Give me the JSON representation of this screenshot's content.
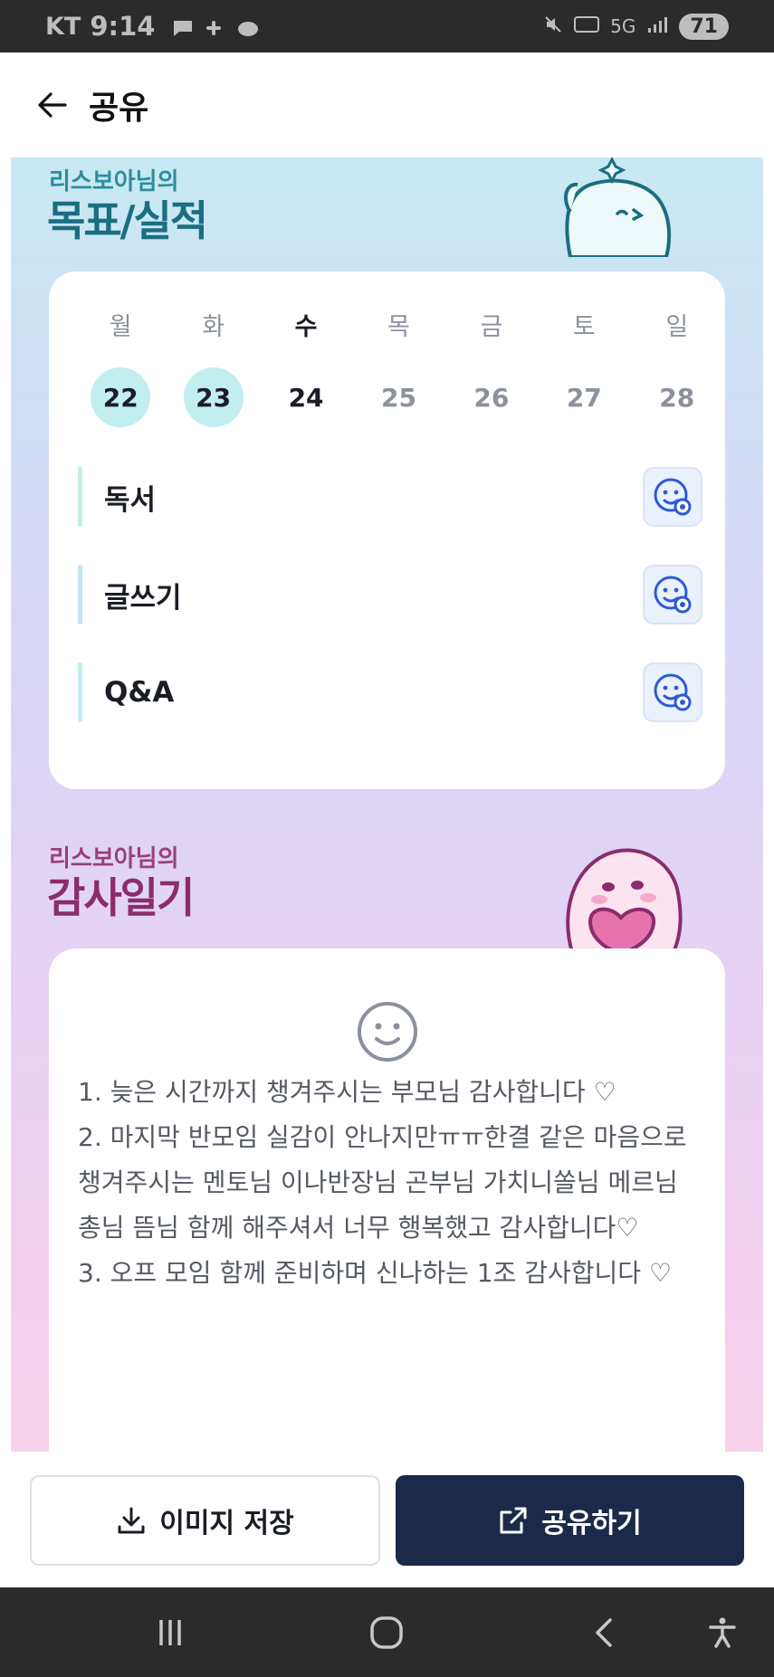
{
  "status_bar": {
    "carrier": "KT",
    "time": "9:14",
    "network": "5G",
    "battery": "71"
  },
  "header": {
    "title": "공유",
    "back_icon": "arrow-left-icon"
  },
  "goals_section": {
    "subtitle": "리스보아님의",
    "title": "목표/실적",
    "days_of_week": [
      "월",
      "화",
      "수",
      "목",
      "금",
      "토",
      "일"
    ],
    "dates": [
      "22",
      "23",
      "24",
      "25",
      "26",
      "27",
      "28"
    ],
    "completed_dates": [
      "22",
      "23"
    ],
    "today": "24",
    "items": [
      {
        "label": "독서",
        "icon": "add-emoji-icon"
      },
      {
        "label": "글쓰기",
        "icon": "add-emoji-icon"
      },
      {
        "label": "Q&A",
        "icon": "add-emoji-icon"
      }
    ]
  },
  "gratitude_section": {
    "subtitle": "리스보아님의",
    "title": "감사일기",
    "icon": "smile-icon",
    "text": "1. 늦은 시간까지 챙겨주시는 부모님 감사합니다 ♡\n2. 마지막 반모임 실감이 안나지만ㅠㅠ한결 같은 마음으로 챙겨주시는 멘토님 이나반장님 곤부님 가치니쏠님 메르님 총님 뜸님 함께 해주셔서 너무 행복했고 감사합니다♡\n3. 오프 모임 함께 준비하며 신나하는 1조 감사합니다 ♡"
  },
  "actions": {
    "save_label": "이미지 저장",
    "share_label": "공유하기"
  },
  "colors": {
    "accent_dark": "#1c2a4a",
    "goal_title": "#1a6e80",
    "gratitude_title": "#8b2c6c",
    "completed_day": "#c2eef0"
  }
}
